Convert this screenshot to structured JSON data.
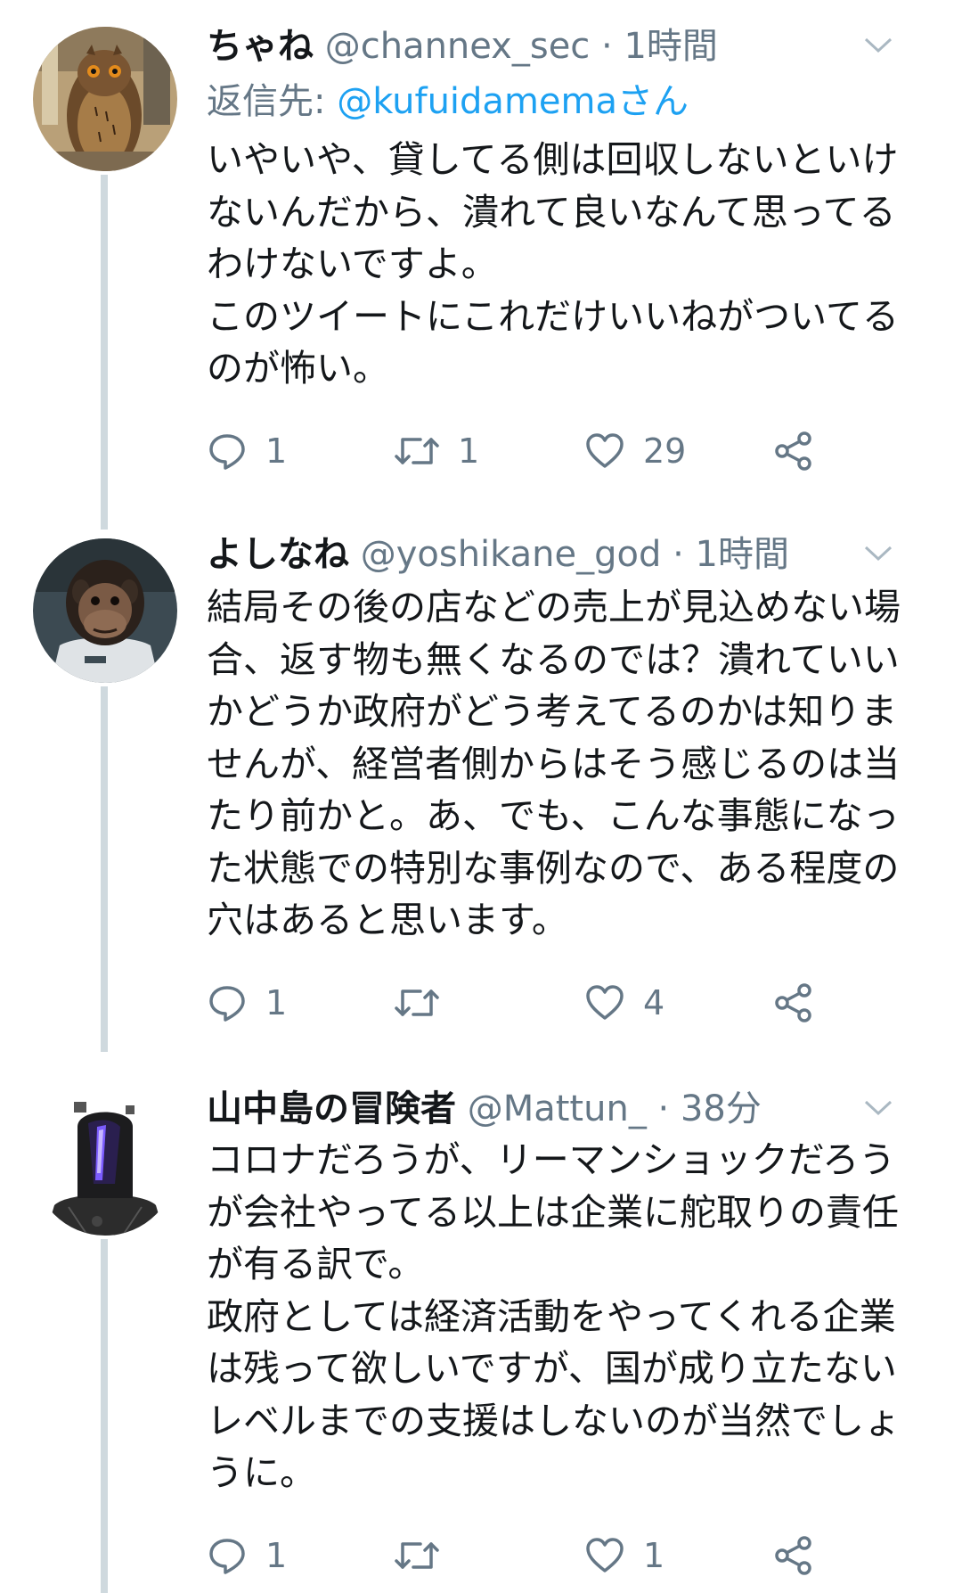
{
  "tweets": [
    {
      "name": "ちゃね",
      "handle": "@channex_sec",
      "time": "1時間",
      "sep": "·",
      "reply_to_label": "返信先:",
      "reply_to_mention": "@kufuidamemaさん",
      "text": "いやいや、貸してる側は回収しないといけないんだから、潰れて良いなんて思ってるわけないですよ。\nこのツイートにこれだけいいねがついてるのが怖い。",
      "reply_count": "1",
      "retweet_count": "1",
      "like_count": "29",
      "avatar": "owl-avatar"
    },
    {
      "name": "よしなね",
      "handle": "@yoshikane_god",
      "time": "1時間",
      "sep": "·",
      "text": "結局その後の店などの売上が見込めない場合、返す物も無くなるのでは？潰れていいかどうか政府がどう考えてるのかは知りませんが、経営者側からはそう感じるのは当たり前かと。あ、でも、こんな事態になった状態での特別な事例なので、ある程度の穴はあると思います。",
      "reply_count": "1",
      "retweet_count": "",
      "like_count": "4",
      "avatar": "chimp-avatar"
    },
    {
      "name": "山中島の冒険者",
      "handle": "@Mattun_",
      "time": "38分",
      "sep": "·",
      "text": "コロナだろうが、リーマンショックだろうが会社やってる以上は企業に舵取りの責任が有る訳で。\n政府としては経済活動をやってくれる企業は残って欲しいですが、国が成り立たないレベルまでの支援はしないのが当然でしょうに。",
      "reply_count": "1",
      "retweet_count": "",
      "like_count": "1",
      "avatar": "helmet-avatar"
    }
  ],
  "colors": {
    "text": "#14171a",
    "muted": "#657786",
    "link": "#1da1f2",
    "thread_line": "#cfd9de"
  },
  "icons": [
    "reply-icon",
    "retweet-icon",
    "like-icon",
    "share-icon",
    "chevron-down-icon"
  ]
}
